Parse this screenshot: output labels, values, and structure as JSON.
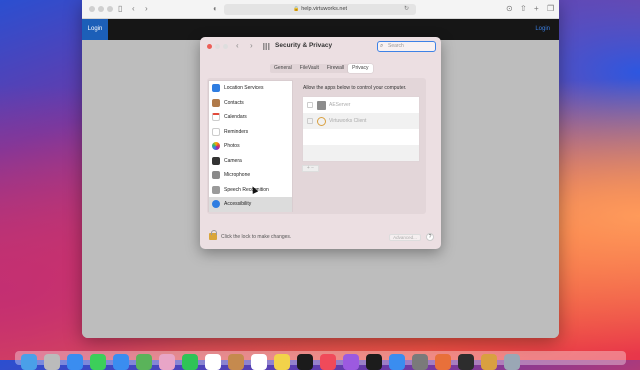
{
  "browser": {
    "url": "help.virtuworks.net",
    "back_icon": "chevron-left-icon",
    "forward_icon": "chevron-right-icon"
  },
  "site": {
    "login_left": "Login",
    "login_right": "Login",
    "header_color": "#161616",
    "login_color": "#1c5fb8"
  },
  "prefs": {
    "title": "Security & Privacy",
    "search_placeholder": "Search",
    "tabs": [
      {
        "label": "General"
      },
      {
        "label": "FileVault"
      },
      {
        "label": "Firewall"
      },
      {
        "label": "Privacy",
        "active": true
      }
    ],
    "categories": [
      {
        "label": "Location Services",
        "icon": "location-icon"
      },
      {
        "label": "Contacts",
        "icon": "contacts-icon"
      },
      {
        "label": "Calendars",
        "icon": "calendar-icon"
      },
      {
        "label": "Reminders",
        "icon": "reminders-icon"
      },
      {
        "label": "Photos",
        "icon": "photos-icon"
      },
      {
        "label": "Camera",
        "icon": "camera-icon"
      },
      {
        "label": "Microphone",
        "icon": "microphone-icon"
      },
      {
        "label": "Speech Recognition",
        "icon": "speech-icon"
      },
      {
        "label": "Accessibility",
        "icon": "accessibility-icon",
        "selected": true
      }
    ],
    "right_title": "Allow the apps below to control your computer.",
    "apps": [
      {
        "name": "AEServer",
        "icon": "aeserver-icon"
      },
      {
        "name": "Virtuworks Client",
        "icon": "virtuworks-icon"
      }
    ],
    "plus_minus": "+ −",
    "lock_text": "Click the lock to make changes.",
    "advanced_label": "Advanced...",
    "help_label": "?",
    "accent": "#3e82e6"
  }
}
